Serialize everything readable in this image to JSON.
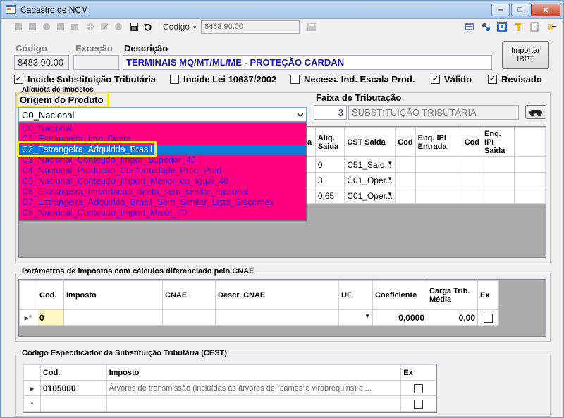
{
  "window": {
    "title": "Cadastro de NCM",
    "buttons": {
      "minimize": "–",
      "maximize": "□",
      "close": "✕"
    }
  },
  "toolbar": {
    "codigo_label": "Codigo",
    "codigo_value": "8483.90.00"
  },
  "form": {
    "codigo_label": "Código",
    "codigo_value": "8483.90.00",
    "excecao_label": "Exceção",
    "descricao_label": "Descrição",
    "descricao_value": "TERMINAIS MQ/MT/ML/ME - PROTEÇÃO CARDAN",
    "importar_button": "Importar IBPT"
  },
  "checkboxes": [
    {
      "label": "Incide Substituição Tributária",
      "checked": true
    },
    {
      "label": "Incide Lei 10637/2002",
      "checked": false
    },
    {
      "label": "Necess. Ind. Escala Prod.",
      "checked": false
    },
    {
      "label": "Válido",
      "checked": true
    },
    {
      "label": "Revisado",
      "checked": true
    }
  ],
  "aliquota": {
    "group_label": "Alíquota de Impostos",
    "origem_label": "Origem do Produto",
    "origem_value": "C0_Nacional",
    "options": [
      "C0_Nacional",
      "C1_Estrangeira_Imp_Direta",
      "C2_Estrangeira_Adquirida_Brasil",
      "C3_Nacional_Conteudo_Impor_Superior_40",
      "C4_Nacional_Producao_Conformidade_Proc_Prod",
      "C5_Nacional_Conteudo_Import_Menor_ou_Igual_40",
      "C6_Estrangeira_Importacao_direta_sem_similar_nacional",
      "C7_Estrangeira_Adquirida_Brasil_Sem_Similar_Lista_Siscomex",
      "C8_Nacional_Conteudo_Import_Maior_70"
    ],
    "selected_index": 2
  },
  "faixa": {
    "label": "Faixa de Tributação",
    "code": "3",
    "description": "SUBSTITUIÇÃO TRIBUTÁRIA"
  },
  "tax_grid": {
    "headers": [
      "a",
      "Aliq. Saida",
      "CST Saida",
      "Cod",
      "Enq. IPI Entrada",
      "Cod",
      "Enq. IPI Saida"
    ],
    "rows": [
      {
        "aliq": "0",
        "cst": "C51_Saíd..."
      },
      {
        "aliq": "3",
        "cst": "C01_Oper..."
      },
      {
        "aliq": "0,65",
        "cst": "C01_Oper..."
      }
    ]
  },
  "cnae": {
    "group_label": "Parâmetros de impostos com cálculos diferenciado pelo CNAE",
    "headers": [
      "Cod.",
      "Imposto",
      "CNAE",
      "Descr. CNAE",
      "UF",
      "Coeficiente",
      "Carga Trib. Média",
      "Ex"
    ],
    "row": {
      "marker": "▸*",
      "cod": "0",
      "coeficiente": "0,0000",
      "carga": "0,00"
    }
  },
  "cest": {
    "group_label": "Código Especificador da Substituição Tributária (CEST)",
    "headers": [
      "Cod.",
      "Imposto",
      "Ex"
    ],
    "rows": [
      {
        "marker": "▸",
        "cod": "0105000",
        "imposto": "Árvores de transmissão (incluídas as árvores de \"cames\"e virabrequins) e ..."
      },
      {
        "marker": "*",
        "cod": "",
        "imposto": ""
      }
    ]
  },
  "colors": {
    "dropdown_bg": "#ff0080",
    "dropdown_text": "#3a00c8",
    "selection": "#0a7bd6",
    "highlight": "#f6ef15",
    "descricao_text": "#1a1aa8"
  }
}
